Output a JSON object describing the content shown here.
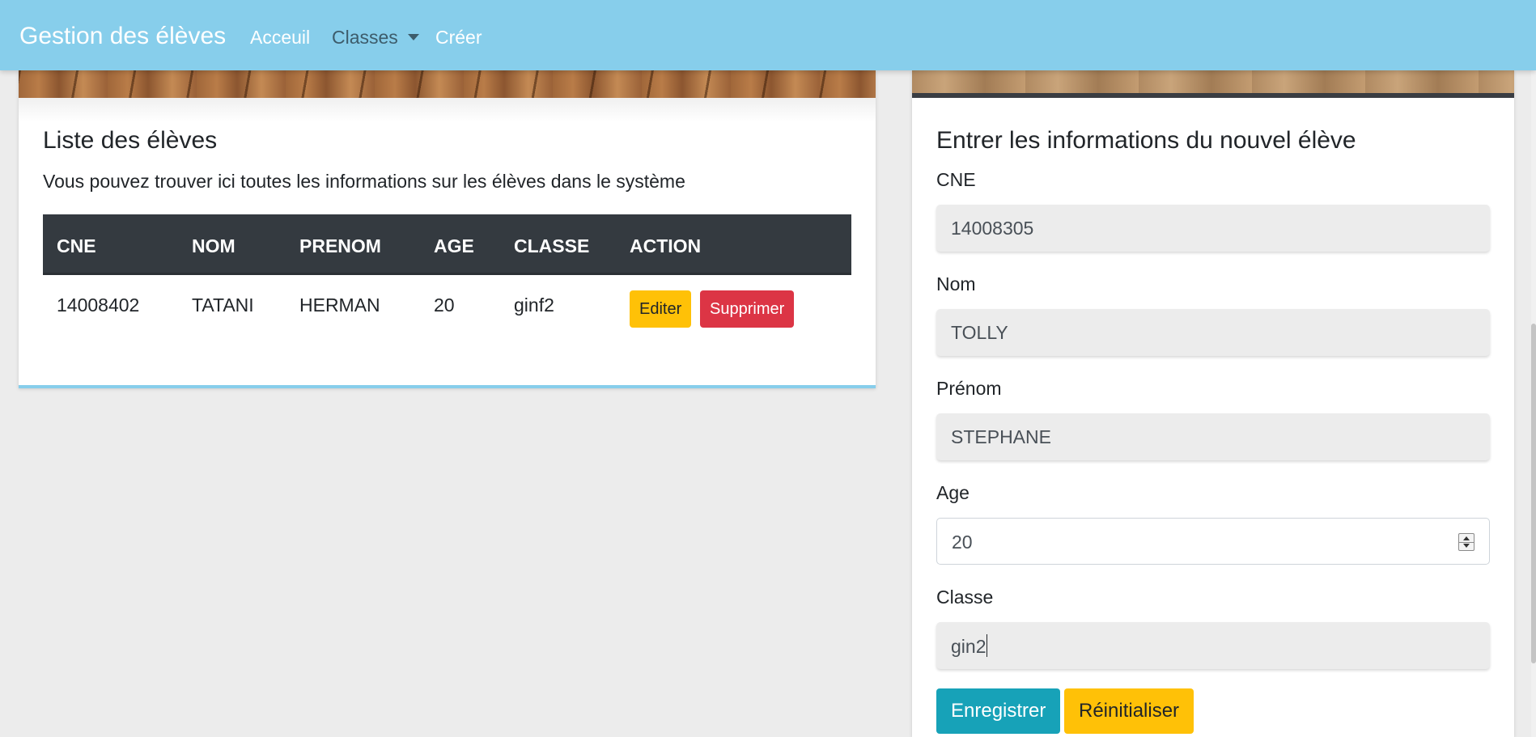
{
  "navbar": {
    "brand": "Gestion des élèves",
    "links": {
      "home": "Acceuil",
      "classes": "Classes",
      "create": "Créer"
    }
  },
  "list_card": {
    "title": "Liste des élèves",
    "description": "Vous pouvez trouver ici toutes les informations sur les élèves dans le système",
    "table": {
      "headers": [
        "CNE",
        "NOM",
        "PRENOM",
        "AGE",
        "CLASSE",
        "ACTION"
      ],
      "rows": [
        {
          "cne": "14008402",
          "nom": "TATANI",
          "prenom": "HERMAN",
          "age": "20",
          "classe": "ginf2",
          "edit_label": "Editer",
          "delete_label": "Supprimer"
        }
      ]
    }
  },
  "form_card": {
    "title": "Entrer les informations du nouvel élève",
    "fields": {
      "cne": {
        "label": "CNE",
        "value": "14008305"
      },
      "nom": {
        "label": "Nom",
        "value": "TOLLY"
      },
      "prenom": {
        "label": "Prénom",
        "value": "STEPHANE"
      },
      "age": {
        "label": "Age",
        "value": "20"
      },
      "classe": {
        "label": "Classe",
        "value": "gin2"
      }
    },
    "buttons": {
      "submit": "Enregistrer",
      "reset": "Réinitialiser"
    }
  },
  "colors": {
    "navbar": "#87ceeb",
    "table_header": "#343a40",
    "warning": "#ffc107",
    "danger": "#dc3545",
    "info": "#17a2b8",
    "background": "#ececec"
  }
}
